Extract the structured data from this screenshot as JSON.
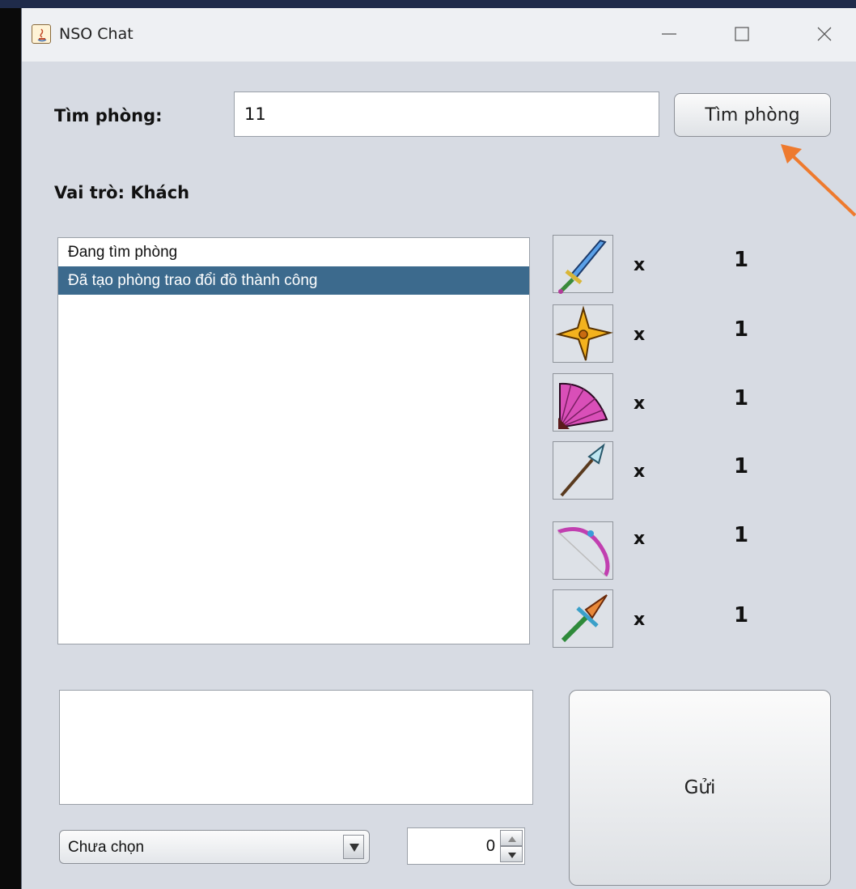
{
  "window": {
    "title": "NSO Chat"
  },
  "search": {
    "label": "Tìm phòng:",
    "value": "11",
    "button_label": "Tìm phòng"
  },
  "role": {
    "label": "Vai trò: Khách"
  },
  "log": {
    "items": [
      {
        "text": "Đang tìm phòng",
        "selected": false
      },
      {
        "text": "Đã tạo phòng trao đổi đồ thành công",
        "selected": true
      }
    ]
  },
  "items": [
    {
      "icon": "sword-icon",
      "x": "x",
      "qty": "1"
    },
    {
      "icon": "shuriken-icon",
      "x": "x",
      "qty": "1"
    },
    {
      "icon": "fan-icon",
      "x": "x",
      "qty": "1"
    },
    {
      "icon": "spear-icon",
      "x": "x",
      "qty": "1"
    },
    {
      "icon": "bow-icon",
      "x": "x",
      "qty": "1"
    },
    {
      "icon": "dagger-icon",
      "x": "x",
      "qty": "1"
    }
  ],
  "compose": {
    "send_label": "Gửi"
  },
  "select": {
    "value": "Chưa chọn"
  },
  "quantity": {
    "value": "0"
  },
  "colors": {
    "selection": "#3c6a8d",
    "annotation": "#ee7a2e",
    "window_bg": "#d7dbe3"
  }
}
